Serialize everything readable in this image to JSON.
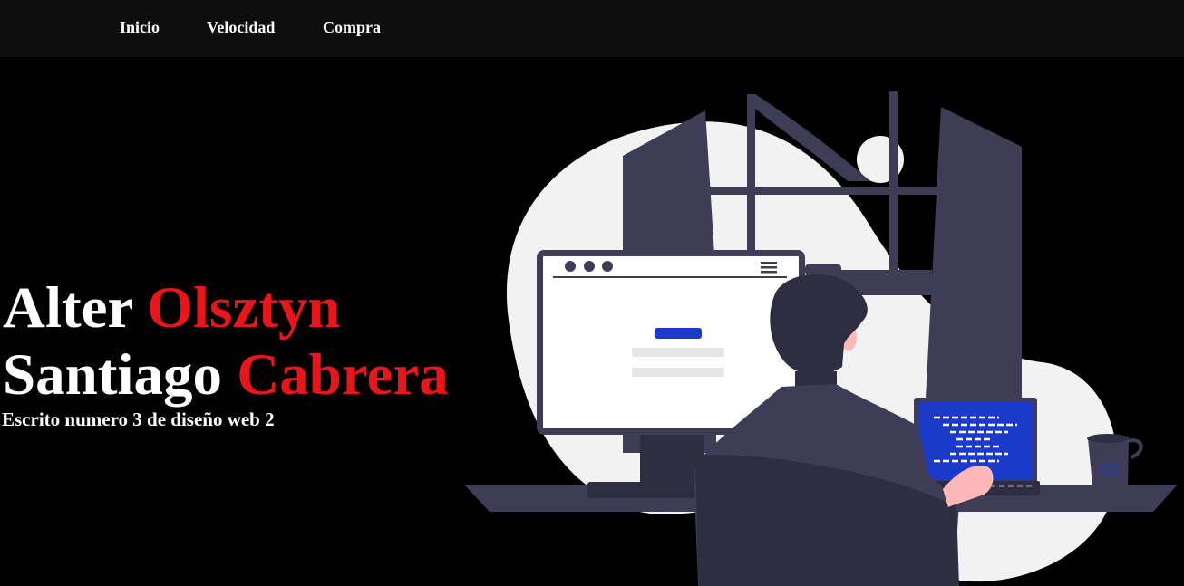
{
  "nav": {
    "items": [
      {
        "label": "Inicio"
      },
      {
        "label": "Velocidad"
      },
      {
        "label": "Compra"
      }
    ]
  },
  "hero": {
    "line1_white": "Alter",
    "line1_red": "Olsztyn",
    "line2_white": "Santiago",
    "line2_red": "Cabrera",
    "subtitle": "Escrito numero 3 de diseño web 2"
  },
  "colors": {
    "background": "#000000",
    "navbar": "#0e0e0e",
    "accent": "#e8161b",
    "illustration_dark": "#3f3d56",
    "illustration_light": "#f2f2f2",
    "illustration_blue": "#1a3ac7",
    "skin": "#ffb8b8"
  }
}
